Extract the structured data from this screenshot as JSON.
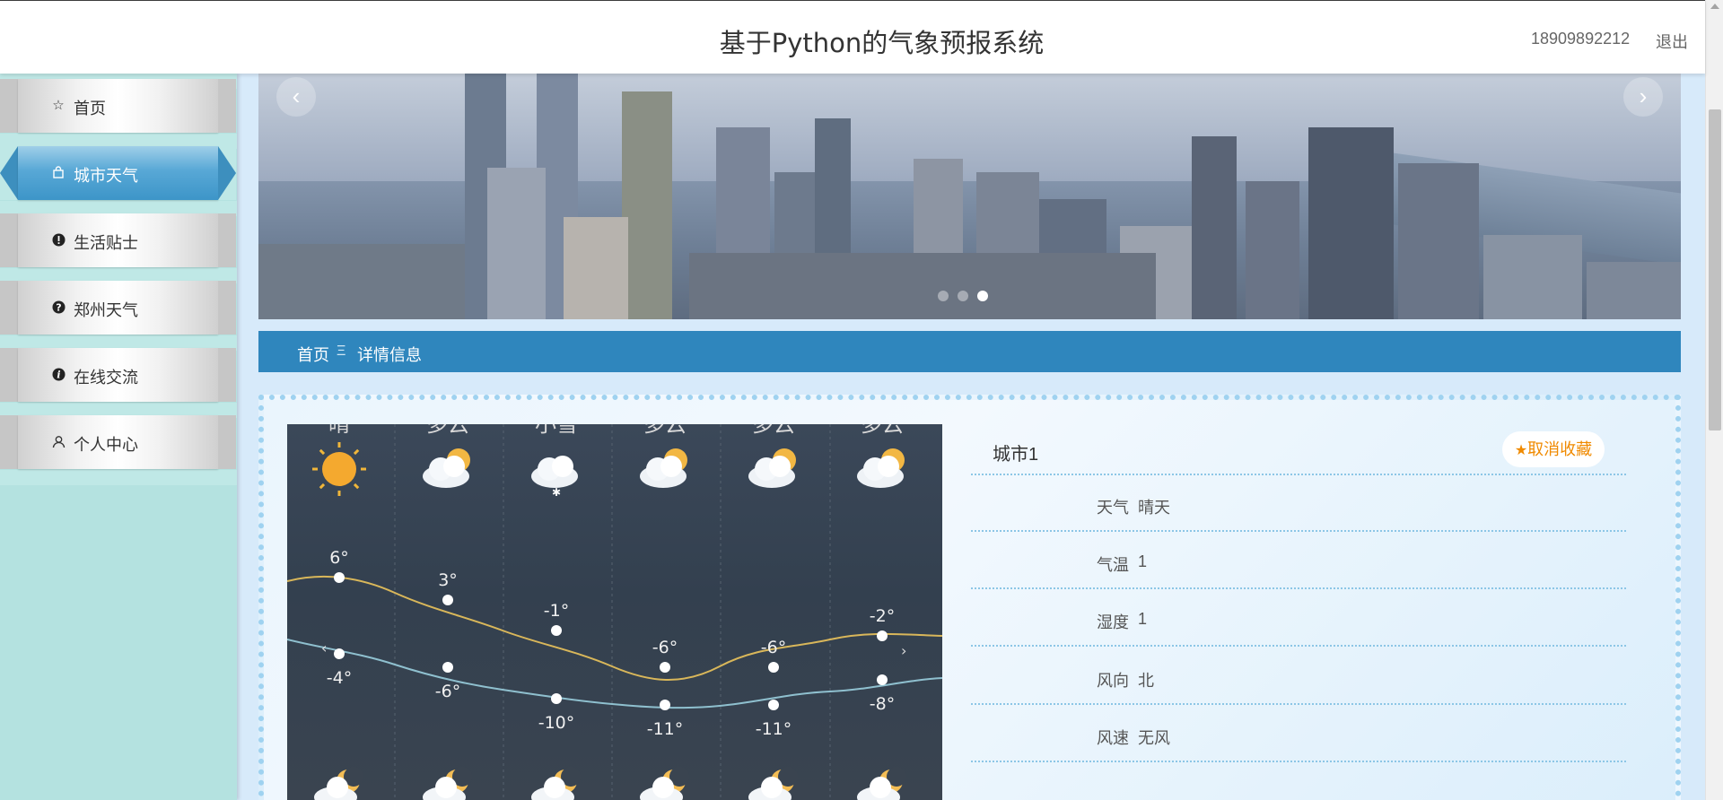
{
  "header": {
    "title": "基于Python的气象预报系统",
    "phone": "18909892212",
    "logout": "退出"
  },
  "sidebar": {
    "items": [
      {
        "label": "首页",
        "icon": "star-icon",
        "active": false
      },
      {
        "label": "城市天气",
        "icon": "bag-icon",
        "active": true
      },
      {
        "label": "生活贴士",
        "icon": "exclamation-icon",
        "active": false
      },
      {
        "label": "郑州天气",
        "icon": "question-icon",
        "active": false
      },
      {
        "label": "在线交流",
        "icon": "info-icon",
        "active": false
      },
      {
        "label": "个人中心",
        "icon": "user-icon",
        "active": false
      }
    ]
  },
  "banner": {
    "prev": "‹",
    "next": "›",
    "slide_count": 3,
    "active_slide": 3
  },
  "breadcrumb": {
    "home": "首页",
    "separator": "Ξ",
    "current": "详情信息"
  },
  "weather_image": {
    "conditions": [
      "晴",
      "多云",
      "小雪",
      "多云",
      "多云",
      "多云"
    ],
    "high_temps": [
      "6°",
      "3°",
      "-1°",
      "-6°",
      "-6°",
      "-2°"
    ],
    "low_temps": [
      "-4°",
      "-6°",
      "-10°",
      "-11°",
      "-11°",
      "-8°"
    ]
  },
  "detail": {
    "city": "城市1",
    "favorite_button": "取消收藏",
    "rows": [
      {
        "key": "天气",
        "value": "晴天"
      },
      {
        "key": "气温",
        "value": "1"
      },
      {
        "key": "湿度",
        "value": "1"
      },
      {
        "key": "风向",
        "value": "北"
      },
      {
        "key": "风速",
        "value": "无风"
      }
    ]
  },
  "colors": {
    "accent": "#2f86bd",
    "sidebar_bg": "#b4e2e0",
    "favorite": "#f08a00"
  }
}
